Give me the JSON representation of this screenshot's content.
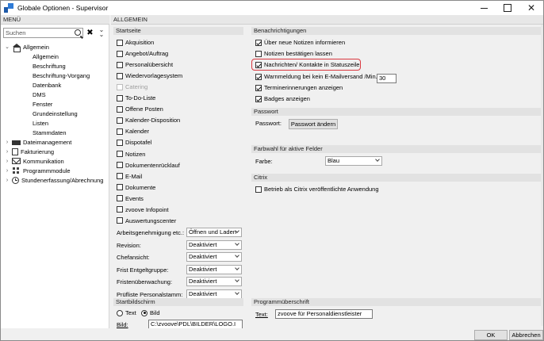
{
  "window": {
    "title": "Globale Optionen - Supervisor"
  },
  "menu": {
    "header": "MENÜ",
    "search_placeholder": "Suchen",
    "tree": [
      {
        "label": "Allgemein",
        "level": 0,
        "toggle": "⌄",
        "icon": "house-icon",
        "expanded": true
      },
      {
        "label": "Allgemein",
        "level": 1
      },
      {
        "label": "Beschriftung",
        "level": 1
      },
      {
        "label": "Beschriftung-Vorgang",
        "level": 1
      },
      {
        "label": "Datenbank",
        "level": 1
      },
      {
        "label": "DMS",
        "level": 1
      },
      {
        "label": "Fenster",
        "level": 1
      },
      {
        "label": "Grundeinstellung",
        "level": 1
      },
      {
        "label": "Listen",
        "level": 1
      },
      {
        "label": "Stammdaten",
        "level": 1
      },
      {
        "label": "Dateimanagement",
        "level": 0,
        "toggle": "›",
        "icon": "keyboard-icon"
      },
      {
        "label": "Fakturierung",
        "level": 0,
        "toggle": "›",
        "icon": "document-icon"
      },
      {
        "label": "Kommunikation",
        "level": 0,
        "toggle": "›",
        "icon": "mail-icon"
      },
      {
        "label": "Programmmodule",
        "level": 0,
        "toggle": "›",
        "icon": "grid-icon"
      },
      {
        "label": "Stundenerfassung/Abrechnung",
        "level": 0,
        "toggle": "›",
        "icon": "clock-icon"
      }
    ]
  },
  "main": {
    "header": "ALLGEMEIN",
    "startseite": {
      "header": "Startseite",
      "items": [
        {
          "label": "Akquisition",
          "checked": false
        },
        {
          "label": "Angebot/Auftrag",
          "checked": false
        },
        {
          "label": "Personalübersicht",
          "checked": false
        },
        {
          "label": "Wiedervorlagesystem",
          "checked": false
        },
        {
          "label": "Catering",
          "checked": false,
          "disabled": true
        },
        {
          "label": "To-Do-Liste",
          "checked": false
        },
        {
          "label": "Offene Posten",
          "checked": false
        },
        {
          "label": "Kalender-Disposition",
          "checked": false
        },
        {
          "label": "Kalender",
          "checked": false
        },
        {
          "label": "Dispotafel",
          "checked": false
        },
        {
          "label": "Notizen",
          "checked": false
        },
        {
          "label": "Dokumentenrücklauf",
          "checked": false
        },
        {
          "label": "E-Mail",
          "checked": false
        },
        {
          "label": "Dokumente",
          "checked": false
        },
        {
          "label": "Events",
          "checked": false
        },
        {
          "label": "zvoove Infopoint",
          "checked": false
        },
        {
          "label": "Auswertungscenter",
          "checked": false
        }
      ],
      "dropdowns": [
        {
          "label": "Arbeitsgenehmigung etc.:",
          "value": "Öffnen und Laden"
        },
        {
          "label": "Revision:",
          "value": "Deaktiviert"
        },
        {
          "label": "Chefansicht:",
          "value": "Deaktiviert"
        },
        {
          "label": "Frist Entgeltgruppe:",
          "value": "Deaktiviert"
        },
        {
          "label": "Fristenüberwachung:",
          "value": "Deaktiviert"
        },
        {
          "label": "Prüfliste Personalstamm:",
          "value": "Deaktiviert"
        }
      ]
    },
    "benachrichtigungen": {
      "header": "Benachrichtigungen",
      "items": [
        {
          "label": "Über neue Notizen informieren",
          "checked": true
        },
        {
          "label": "Notizen bestätigen lassen",
          "checked": false
        },
        {
          "label": "Nachrichten/ Kontakte in Statuszeile",
          "checked": true
        },
        {
          "label": "Warnmeldung bei kein E-Mailversand /Min.",
          "checked": true
        },
        {
          "label": "Terminerinnerungen anzeigen",
          "checked": true
        },
        {
          "label": "Badges anzeigen",
          "checked": true
        }
      ],
      "minutes_value": "30"
    },
    "passwort": {
      "header": "Passwort",
      "label": "Passwort:",
      "button": "Passwort ändern"
    },
    "farbwahl": {
      "header": "Farbwahl für aktive Felder",
      "label": "Farbe:",
      "value": "Blau"
    },
    "citrix": {
      "header": "Citrix",
      "item": {
        "label": "Betrieb als Citrix veröffentlichte Anwendung",
        "checked": false
      }
    },
    "startbildschirm": {
      "header": "Startbildschirm",
      "radio_text": "Text",
      "radio_bild": "Bild",
      "selected": "Bild",
      "bild_label": "Bild:",
      "bild_value": "C:\\zvoove\\PDL\\BILDER\\LOGO.I"
    },
    "programmueberschrift": {
      "header": "Programmüberschrift",
      "text_label": "Text:",
      "text_value": "zvoove für Personaldienstleister"
    }
  },
  "footer": {
    "ok": "OK",
    "cancel": "Abbrechen"
  },
  "colors": {
    "highlight": "#d9383f"
  }
}
